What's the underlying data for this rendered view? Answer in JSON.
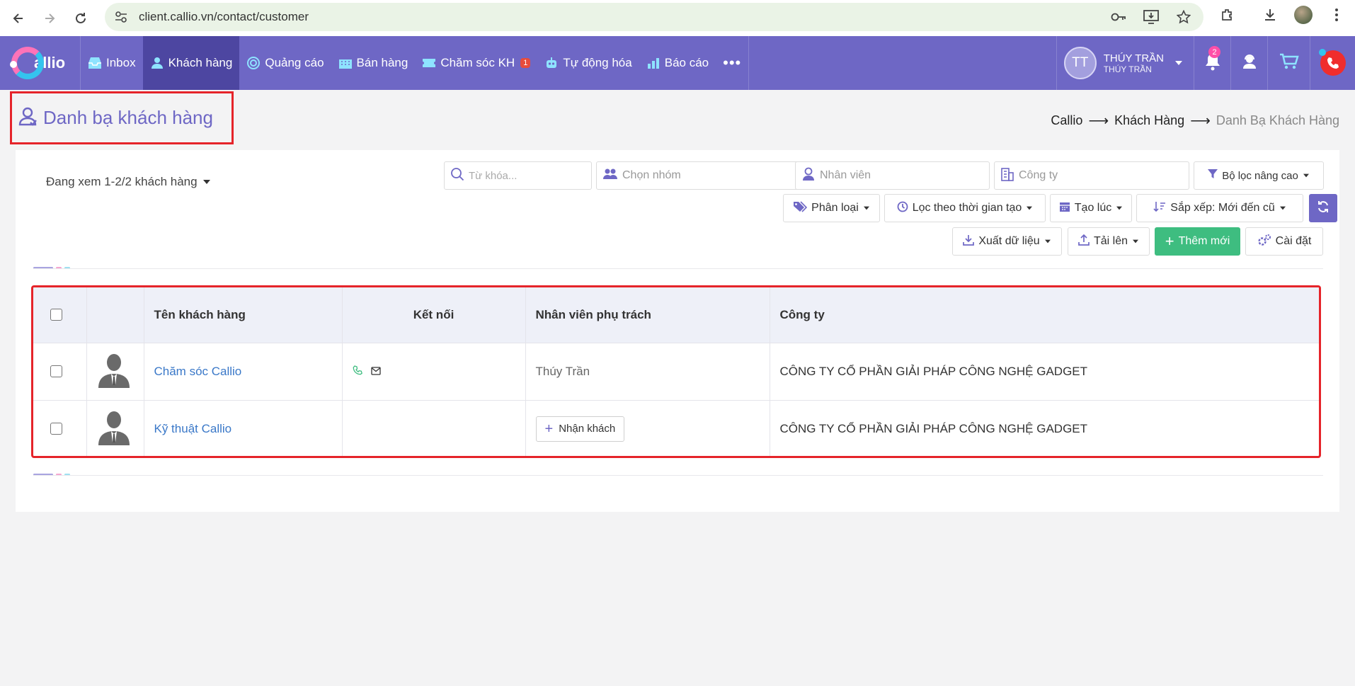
{
  "browser": {
    "url": "client.callio.vn/contact/customer"
  },
  "app": {
    "logo_text": "allio",
    "nav": [
      {
        "label": "Inbox",
        "icon": "inbox-icon"
      },
      {
        "label": "Khách hàng",
        "icon": "customer-icon",
        "active": true
      },
      {
        "label": "Quảng cáo",
        "icon": "target-icon"
      },
      {
        "label": "Bán hàng",
        "icon": "building-icon"
      },
      {
        "label": "Chăm sóc KH",
        "icon": "ticket-icon",
        "badge": "1"
      },
      {
        "label": "Tự động hóa",
        "icon": "robot-icon"
      },
      {
        "label": "Báo cáo",
        "icon": "chart-icon"
      }
    ],
    "more": "•••",
    "user": {
      "initials": "TT",
      "name": "THÚY TRẦN",
      "subname": "THÚY TRẦN"
    },
    "notifications_count": "2"
  },
  "page": {
    "title": "Danh bạ khách hàng",
    "breadcrumb": [
      "Callio",
      "Khách Hàng",
      "Danh Bạ Khách Hàng"
    ],
    "viewing": "Đang xem 1-2/2 khách hàng"
  },
  "filters": {
    "keyword_placeholder": "Từ khóa...",
    "group_placeholder": "Chọn nhóm",
    "staff_placeholder": "Nhân viên",
    "company_placeholder": "Công ty",
    "advanced": "Bộ lọc nâng cao",
    "classify": "Phân loại",
    "time_filter": "Lọc theo thời gian tạo",
    "created": "Tạo lúc",
    "sort": "Sắp xếp: Mới đến cũ",
    "export": "Xuất dữ liệu",
    "upload": "Tải lên",
    "add_new": "Thêm mới",
    "settings": "Cài đặt"
  },
  "table": {
    "headers": [
      "Tên khách hàng",
      "Kết nối",
      "Nhân viên phụ trách",
      "Công ty"
    ],
    "rows": [
      {
        "name": "Chăm sóc Callio",
        "has_connect": true,
        "staff": "Thúy Trần",
        "company": "CÔNG TY CỔ PHẦN GIẢI PHÁP CÔNG NGHỆ GADGET"
      },
      {
        "name": "Kỹ thuật Callio",
        "has_connect": false,
        "staff_action": "Nhận khách",
        "company": "CÔNG TY CỔ PHẦN GIẢI PHÁP CÔNG NGHỆ GADGET"
      }
    ]
  },
  "colors": {
    "brand": "#6e67c5",
    "active_nav": "#4d46a1",
    "highlight": "#e5242a",
    "success": "#3ebd80",
    "link": "#3a78c8"
  }
}
